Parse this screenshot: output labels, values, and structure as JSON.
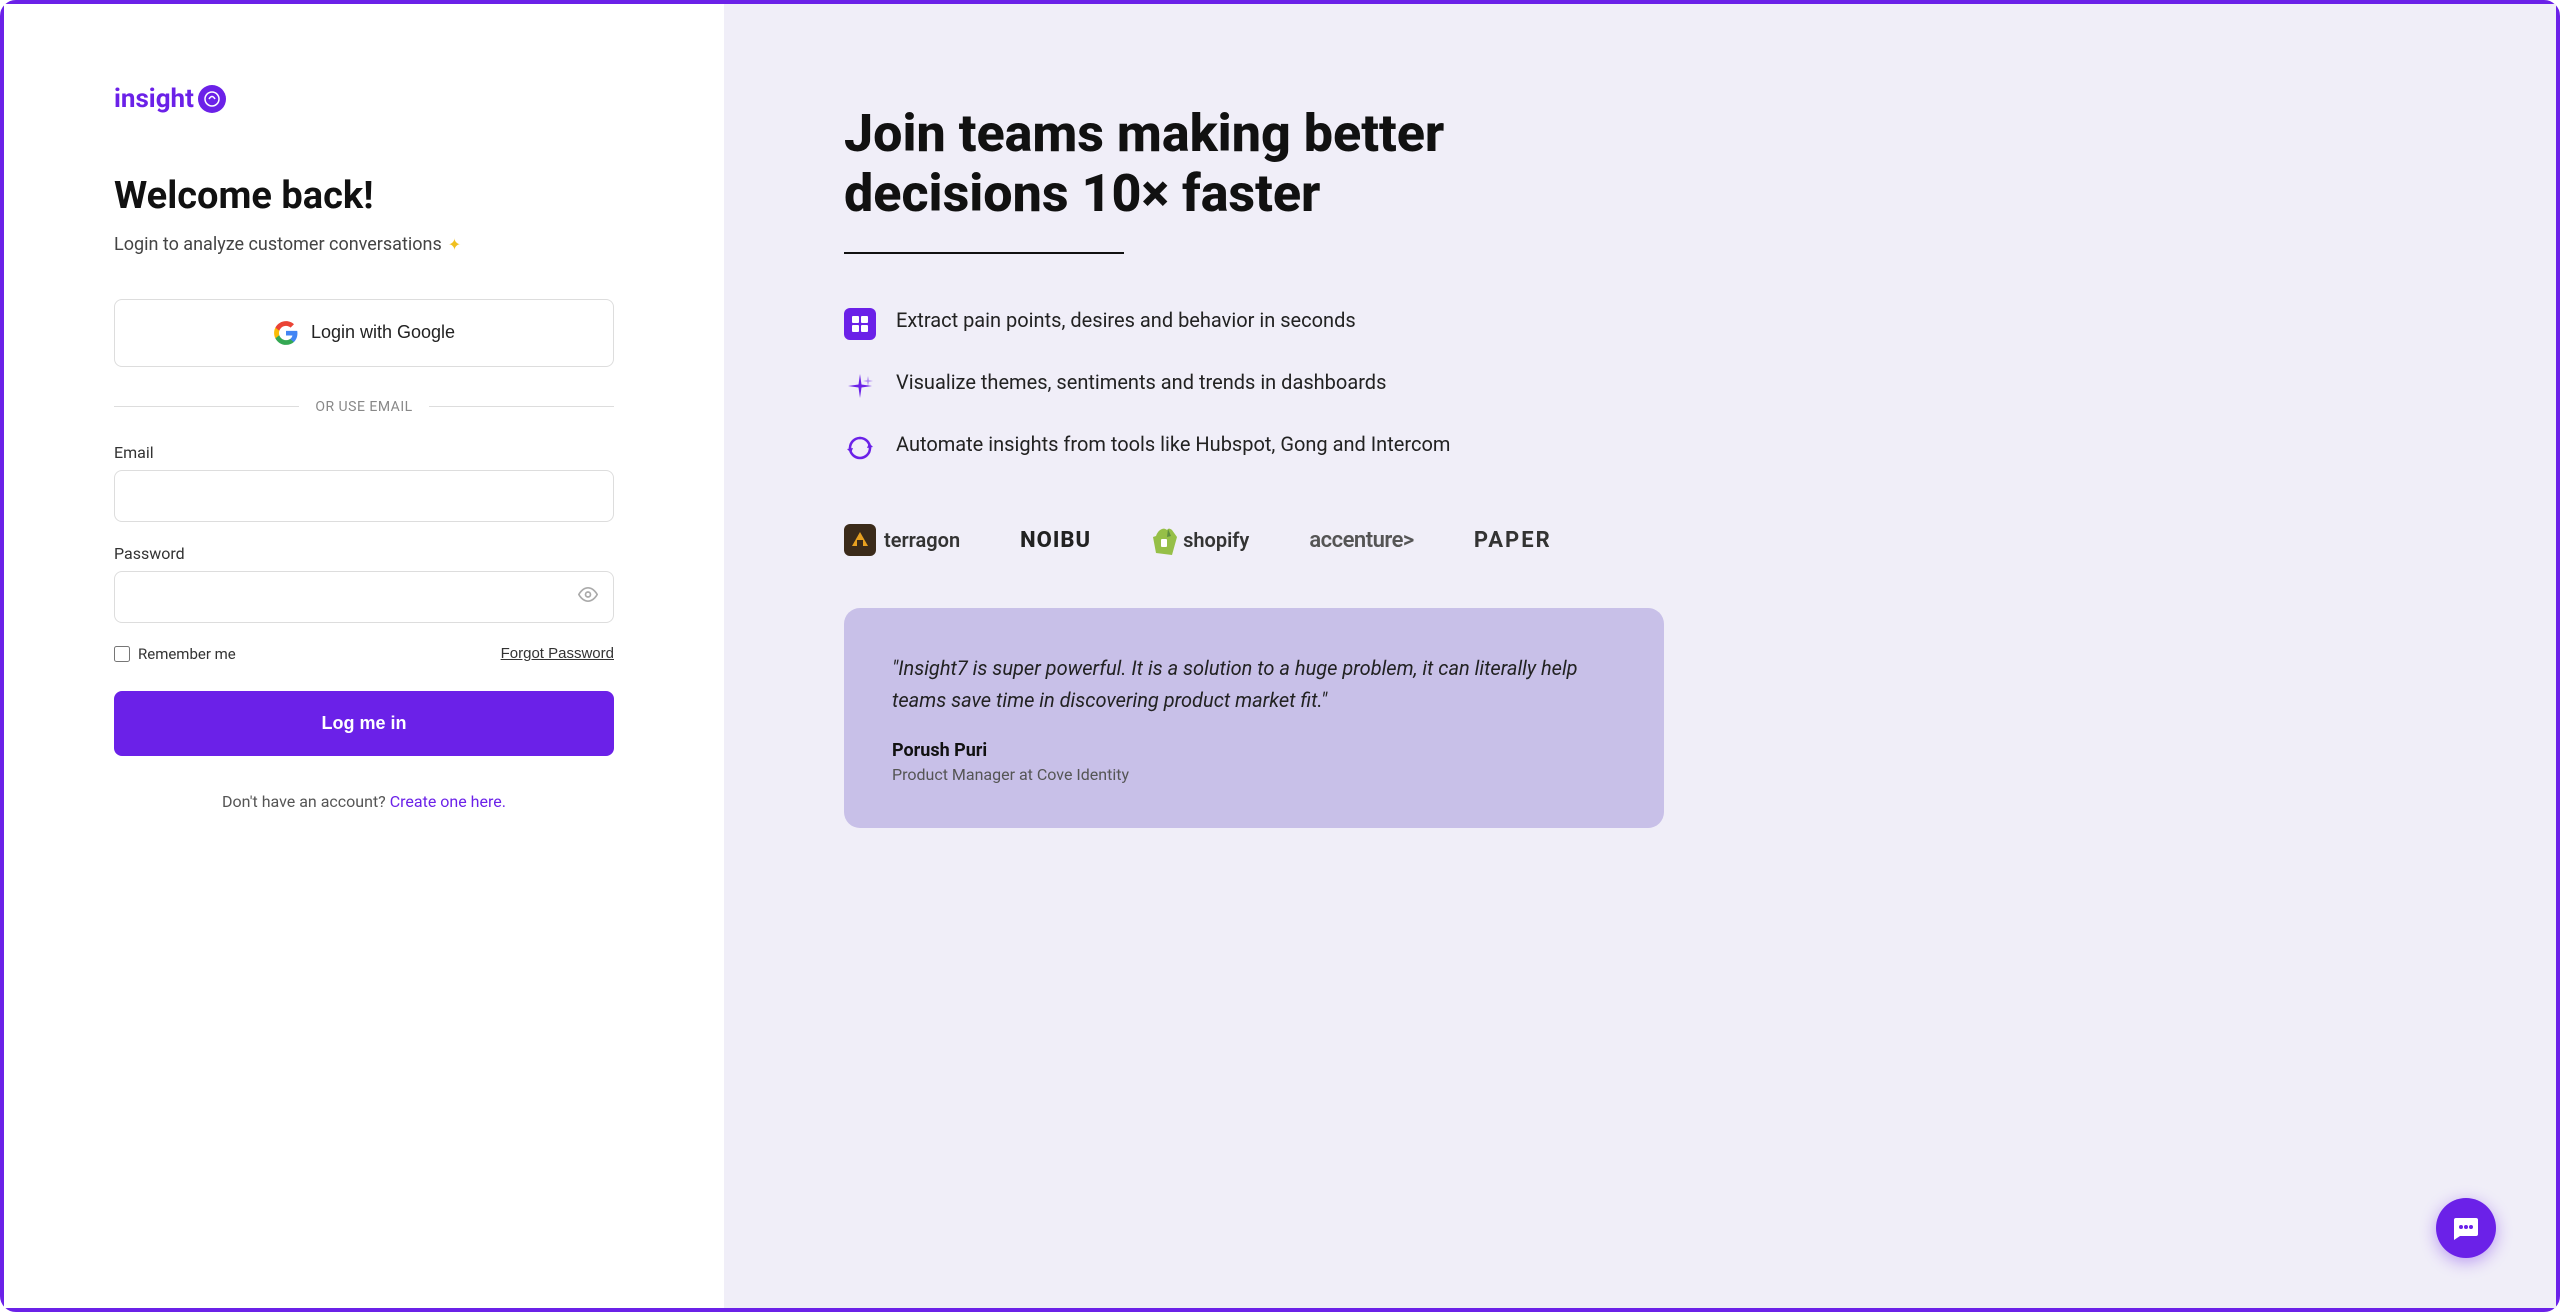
{
  "left": {
    "logo": {
      "text": "insight",
      "icon_symbol": "↗"
    },
    "welcome_title": "Welcome back!",
    "welcome_subtitle": "Login to analyze customer conversations",
    "subtitle_star": "✦",
    "google_button_label": "Login with Google",
    "divider_text": "OR USE EMAIL",
    "email_label": "Email",
    "email_placeholder": "",
    "password_label": "Password",
    "password_placeholder": "",
    "remember_me_label": "Remember me",
    "forgot_password_label": "Forgot Password",
    "login_button_label": "Log me in",
    "no_account_text": "Don't have an account?",
    "create_account_link": "Create one here."
  },
  "right": {
    "tagline": "Join teams making better decisions 10× faster",
    "features": [
      {
        "icon": "■",
        "text": "Extract pain points, desires and behavior in seconds"
      },
      {
        "icon": "✦",
        "text": "Visualize themes, sentiments and trends in dashboards"
      },
      {
        "icon": "↻",
        "text": "Automate insights from tools like Hubspot, Gong and Intercom"
      }
    ],
    "brands": [
      {
        "name": "terragon",
        "type": "icon-text"
      },
      {
        "name": "NOIBU",
        "type": "text"
      },
      {
        "name": "shopify",
        "type": "icon-text"
      },
      {
        "name": "accenture",
        "type": "text"
      },
      {
        "name": "PAPER",
        "type": "text"
      }
    ],
    "testimonial": {
      "quote": "\"Insight7 is super powerful. It is a solution to a huge problem, it can literally help teams save time in discovering product market fit.\"",
      "author": "Porush Puri",
      "role": "Product Manager at Cove Identity"
    }
  },
  "colors": {
    "brand_purple": "#6B21E8",
    "bg_left": "#ffffff",
    "bg_right": "#F0EEF8",
    "testimonial_bg": "#C8C0E8"
  }
}
